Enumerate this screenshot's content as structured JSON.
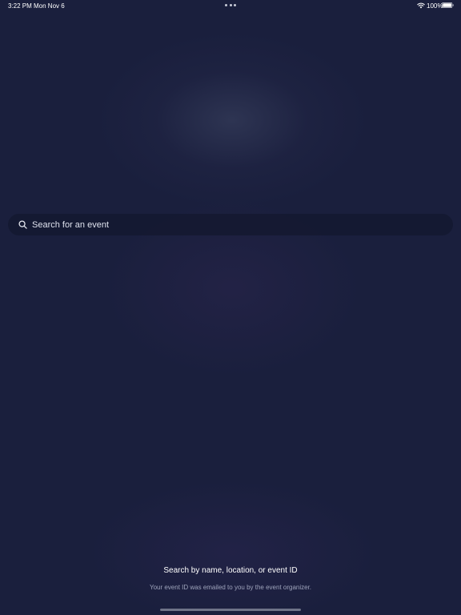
{
  "status_bar": {
    "time": "3:22 PM",
    "date": "Mon Nov 6",
    "battery": "100%",
    "icons": [
      "wifi-icon",
      "battery-icon"
    ]
  },
  "search": {
    "placeholder": "Search for an event",
    "value": "",
    "icon": "search-icon"
  },
  "hint": {
    "title": "Search by name, location, or event ID",
    "subtitle": "Your event ID was emailed to you by the event organizer."
  },
  "colors": {
    "background": "#1a1f3d",
    "search_bar": "#141930",
    "text_primary": "#ffffff",
    "text_secondary": "#9ea3bb"
  }
}
